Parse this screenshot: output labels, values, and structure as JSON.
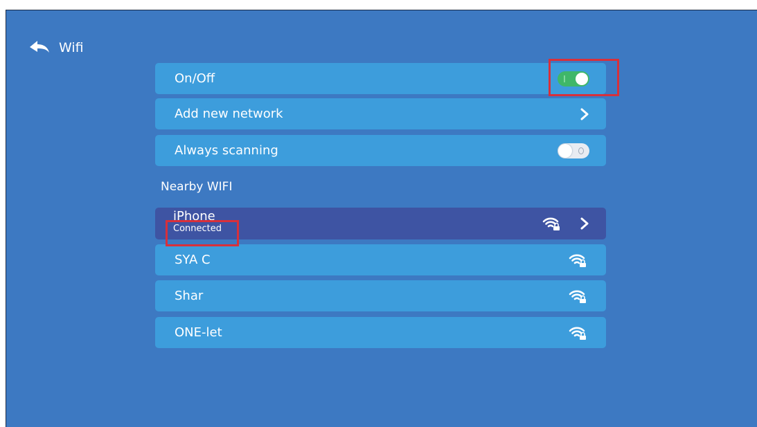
{
  "header": {
    "title": "Wifi",
    "back_icon": "back-arrow-icon"
  },
  "settings": {
    "onoff": {
      "label": "On/Off",
      "state": "on"
    },
    "add_network": {
      "label": "Add new network"
    },
    "always_scanning": {
      "label": "Always scanning",
      "state": "off"
    }
  },
  "nearby": {
    "section_label": "Nearby WIFI",
    "connected": {
      "name": "iPhone",
      "status": "Connected"
    },
    "networks": [
      {
        "name": "SYA C"
      },
      {
        "name": "Shar"
      },
      {
        "name": "ONE-let"
      }
    ]
  },
  "colors": {
    "background": "#3d79c2",
    "row": "#3d9ddc",
    "connected_row": "#3e54a3",
    "toggle_on": "#3fb769",
    "highlight": "#d8303a"
  }
}
